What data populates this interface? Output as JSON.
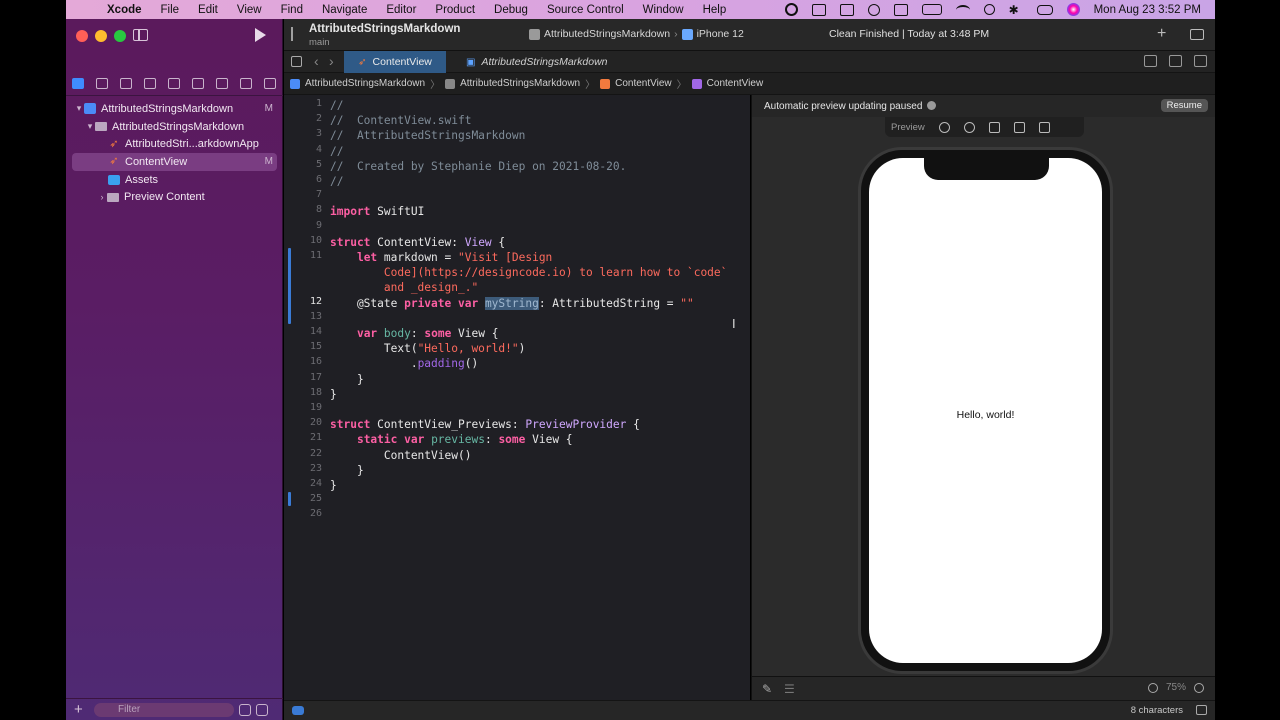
{
  "menubar": {
    "apple": "",
    "app_name": "Xcode",
    "items": [
      "File",
      "Edit",
      "View",
      "Find",
      "Navigate",
      "Editor",
      "Product",
      "Debug",
      "Source Control",
      "Window",
      "Help"
    ],
    "clock": "Mon Aug 23  3:52 PM"
  },
  "toolbar": {
    "project_title": "AttributedStringsMarkdown",
    "branch": "main",
    "scheme": "AttributedStringsMarkdown",
    "scheme_sep": "›",
    "device": "iPhone 12",
    "status": "Clean Finished | Today at 3:48 PM"
  },
  "navigator": {
    "items": [
      {
        "label": "AttributedStringsMarkdown",
        "badge": "M"
      },
      {
        "label": "AttributedStringsMarkdown",
        "badge": ""
      },
      {
        "label": "AttributedStri...arkdownApp",
        "badge": ""
      },
      {
        "label": "ContentView",
        "badge": "M"
      },
      {
        "label": "Assets",
        "badge": ""
      },
      {
        "label": "Preview Content",
        "badge": ""
      }
    ],
    "filter_placeholder": "Filter"
  },
  "tabs": [
    {
      "label": "ContentView"
    },
    {
      "label": "AttributedStringsMarkdown"
    }
  ],
  "breadcrumbs": [
    "AttributedStringsMarkdown",
    "AttributedStringsMarkdown",
    "ContentView",
    "ContentView"
  ],
  "editor": {
    "line_numbers": [
      "1",
      "2",
      "3",
      "4",
      "5",
      "6",
      "7",
      "8",
      "9",
      "10",
      "11",
      "",
      "",
      "12",
      "13",
      "14",
      "15",
      "16",
      "17",
      "18",
      "19",
      "20",
      "21",
      "22",
      "23",
      "24",
      "25",
      "26"
    ],
    "code": [
      [
        "cmt",
        "//"
      ],
      [
        "cmt",
        "//  ContentView.swift"
      ],
      [
        "cmt",
        "//  AttributedStringsMarkdown"
      ],
      [
        "cmt",
        "//"
      ],
      [
        "cmt",
        "//  Created by Stephanie Diep on 2021-08-20."
      ],
      [
        "cmt",
        "//"
      ],
      [
        "pl",
        ""
      ],
      [
        "kw",
        "import",
        "pl",
        " SwiftUI"
      ],
      [
        "pl",
        ""
      ],
      [
        "kw",
        "struct",
        "pl",
        " ContentView: ",
        "ty",
        "View",
        "pl",
        " {"
      ],
      [
        "pl",
        "    ",
        "kw",
        "let",
        "pl",
        " markdown = ",
        "str",
        "\"Visit [Design"
      ],
      [
        "str",
        "        Code](https://designcode.io) to learn how to `code`"
      ],
      [
        "str",
        "        and _design_.\""
      ],
      [
        "pl",
        "    @State ",
        "kw",
        "private var",
        "pl",
        " ",
        "hl",
        "myString",
        "pl",
        ": AttributedString = ",
        "str",
        "\"\""
      ],
      [
        "pl",
        ""
      ],
      [
        "pl",
        "    ",
        "kw",
        "var",
        "pl",
        " ",
        "pid",
        "body",
        "pl",
        ": ",
        "kw",
        "some",
        "pl",
        " View {"
      ],
      [
        "pl",
        "        Text(",
        "str",
        "\"Hello, world!\"",
        "pl",
        ")"
      ],
      [
        "pl",
        "            .",
        "fn",
        "padding",
        "pl",
        "()"
      ],
      [
        "pl",
        "    }"
      ],
      [
        "pl",
        "}"
      ],
      [
        "pl",
        ""
      ],
      [
        "kw",
        "struct",
        "pl",
        " ContentView_Previews: ",
        "ty",
        "PreviewProvider",
        "pl",
        " {"
      ],
      [
        "pl",
        "    ",
        "kw",
        "static var",
        "pl",
        " ",
        "pid",
        "previews",
        "pl",
        ": ",
        "kw",
        "some",
        "pl",
        " View {"
      ],
      [
        "pl",
        "        ContentView()"
      ],
      [
        "pl",
        "    }"
      ],
      [
        "pl",
        "}"
      ],
      [
        "pl",
        ""
      ],
      [
        "pl",
        ""
      ]
    ]
  },
  "preview": {
    "paused_text": "Automatic preview updating paused",
    "resume_label": "Resume",
    "preview_label": "Preview",
    "hello_text": "Hello, world!",
    "zoom": "75%"
  },
  "statusbar": {
    "chars": "8 characters"
  }
}
